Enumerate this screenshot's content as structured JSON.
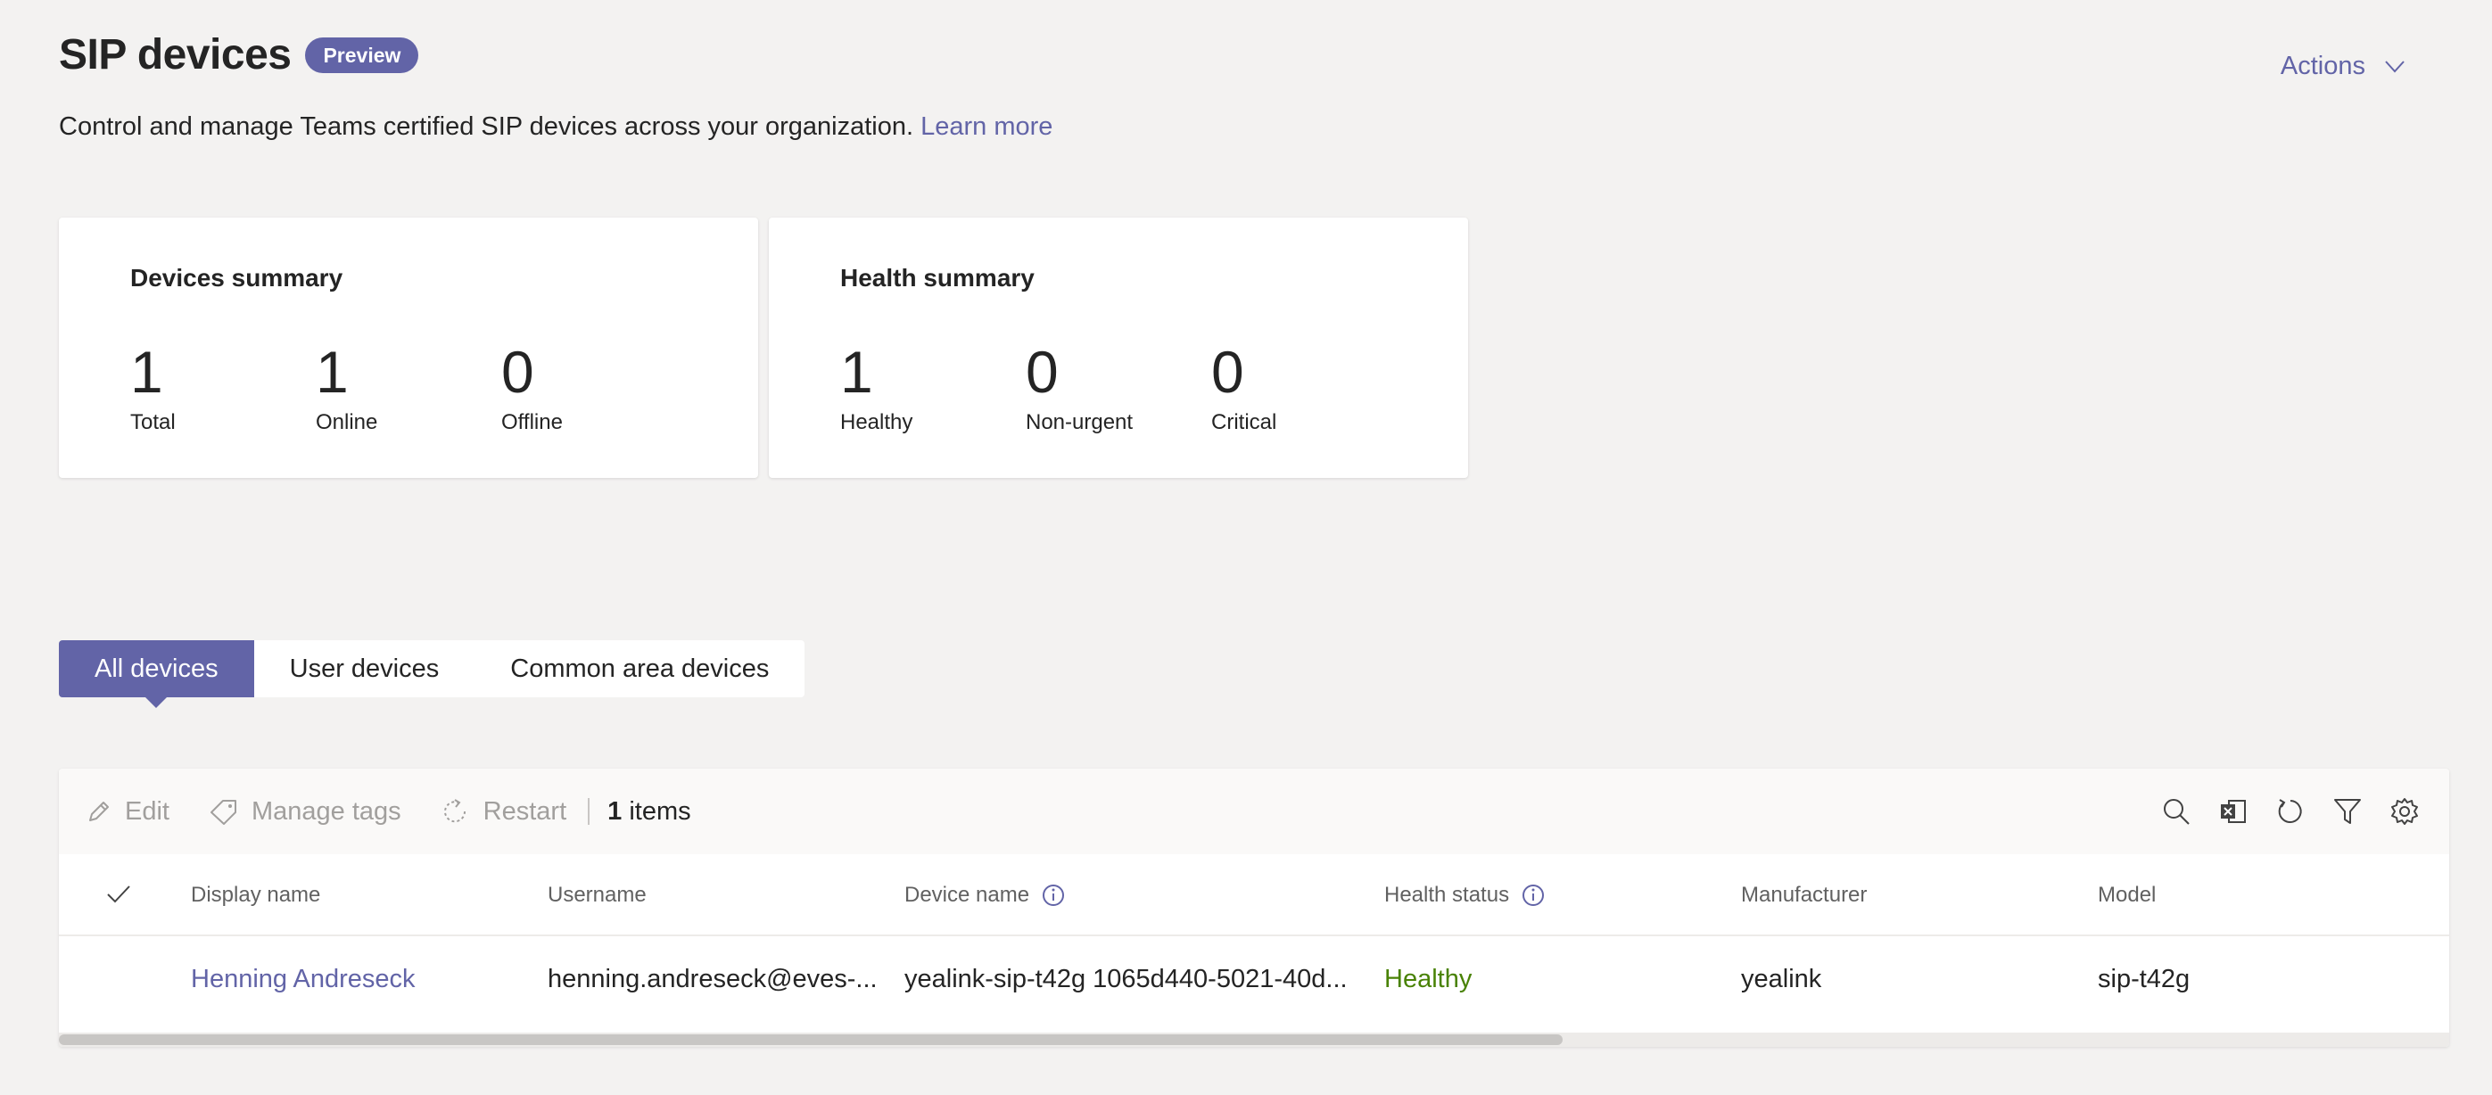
{
  "header": {
    "title": "SIP devices",
    "badge": "Preview",
    "actions_label": "Actions",
    "subtitle": "Control and manage Teams certified SIP devices across your organization.",
    "learn_more": "Learn more"
  },
  "devices_summary": {
    "title": "Devices summary",
    "stats": [
      {
        "value": "1",
        "label": "Total"
      },
      {
        "value": "1",
        "label": "Online"
      },
      {
        "value": "0",
        "label": "Offline"
      }
    ]
  },
  "health_summary": {
    "title": "Health summary",
    "stats": [
      {
        "value": "1",
        "label": "Healthy"
      },
      {
        "value": "0",
        "label": "Non-urgent"
      },
      {
        "value": "0",
        "label": "Critical"
      }
    ]
  },
  "tabs": [
    {
      "label": "All devices",
      "active": true
    },
    {
      "label": "User devices",
      "active": false
    },
    {
      "label": "Common area devices",
      "active": false
    }
  ],
  "toolbar": {
    "edit": "Edit",
    "manage_tags": "Manage tags",
    "restart": "Restart",
    "count": "1",
    "count_suffix": "items",
    "icons": [
      "search-icon",
      "excel-export-icon",
      "refresh-icon",
      "filter-icon",
      "settings-icon"
    ]
  },
  "table": {
    "columns": [
      "Display name",
      "Username",
      "Device name",
      "Health status",
      "Manufacturer",
      "Model"
    ],
    "rows": [
      {
        "display_name": "Henning Andreseck",
        "username": "henning.andreseck@eves-...",
        "device_name": "yealink-sip-t42g 1065d440-5021-40d...",
        "health_status": "Healthy",
        "manufacturer": "yealink",
        "model": "sip-t42g"
      }
    ]
  },
  "colors": {
    "brand": "#6264a7",
    "healthy": "#498205",
    "background": "#f3f2f1"
  }
}
